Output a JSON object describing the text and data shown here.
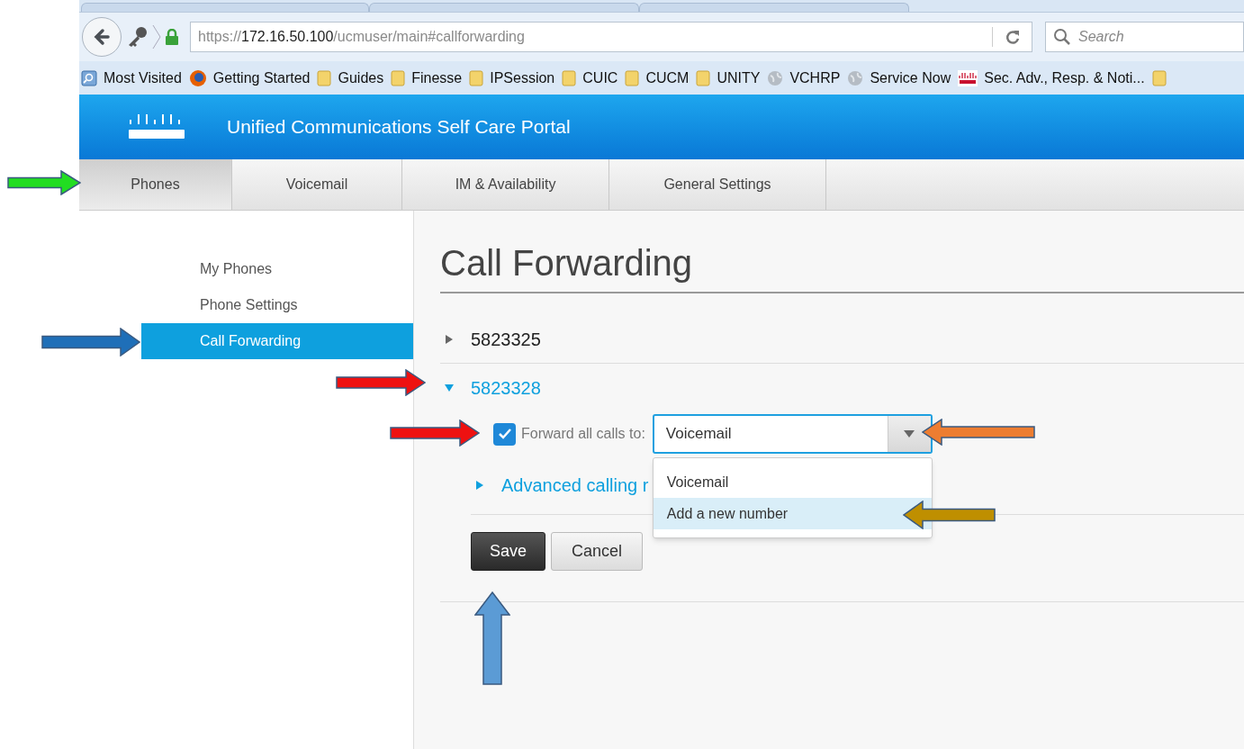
{
  "browser": {
    "url_parts": [
      {
        "text": "https://",
        "kind": "dim"
      },
      {
        "text": "172.16.50.100",
        "kind": "host"
      },
      {
        "text": "/ucmuser/main#callforwarding",
        "kind": "dim"
      }
    ],
    "search": {
      "placeholder": "Search"
    },
    "bookmarks": [
      {
        "label": "Most Visited",
        "kind": "smart"
      },
      {
        "label": "Getting Started",
        "kind": "firefox"
      },
      {
        "label": "Guides",
        "kind": "folder"
      },
      {
        "label": "Finesse",
        "kind": "folder"
      },
      {
        "label": "IPSession",
        "kind": "folder"
      },
      {
        "label": "CUIC",
        "kind": "folder"
      },
      {
        "label": "CUCM",
        "kind": "folder"
      },
      {
        "label": "UNITY",
        "kind": "folder"
      },
      {
        "label": "VCHRP",
        "kind": "globe"
      },
      {
        "label": "Service Now",
        "kind": "globe"
      },
      {
        "label": "Sec. Adv., Resp. & Noti...",
        "kind": "cisco"
      }
    ]
  },
  "header": {
    "title": "Unified Communications Self Care Portal"
  },
  "tabs": [
    {
      "label": "Phones",
      "selected": true
    },
    {
      "label": "Voicemail",
      "selected": false
    },
    {
      "label": "IM & Availability",
      "selected": false
    },
    {
      "label": "General Settings",
      "selected": false
    }
  ],
  "sidebar": {
    "items": [
      {
        "label": "My Phones",
        "selected": false
      },
      {
        "label": "Phone Settings",
        "selected": false
      },
      {
        "label": "Call Forwarding",
        "selected": true
      }
    ]
  },
  "main": {
    "title": "Call Forwarding",
    "lines": [
      {
        "number": "5823325",
        "expanded": false
      },
      {
        "number": "5823328",
        "expanded": true
      }
    ],
    "forward": {
      "checked": true,
      "label": "Forward all calls to:",
      "value": "Voicemail",
      "options": [
        {
          "label": "Voicemail",
          "highlighted": false
        },
        {
          "label": "Add a new number",
          "highlighted": true
        }
      ]
    },
    "advanced": {
      "label": "Advanced calling r",
      "expanded": false
    },
    "buttons": [
      {
        "label": "Save",
        "kind": "primary"
      },
      {
        "label": "Cancel",
        "kind": "secondary"
      }
    ]
  },
  "annotations": [
    {
      "kind": "right",
      "color": "#22dd22"
    },
    {
      "kind": "right",
      "color": "#1f6fb8"
    },
    {
      "kind": "right",
      "color": "#ee1111"
    },
    {
      "kind": "right",
      "color": "#ee1111"
    },
    {
      "kind": "left",
      "color": "#ed7d31"
    },
    {
      "kind": "left",
      "color": "#bf8f00"
    },
    {
      "kind": "up",
      "color": "#5b9bd5"
    }
  ]
}
